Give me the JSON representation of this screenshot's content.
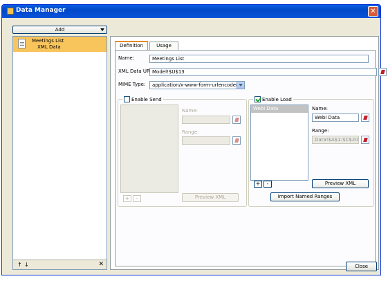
{
  "window": {
    "title": "Data Manager",
    "close_glyph": "✕"
  },
  "toolbar": {
    "add_label": "Add"
  },
  "connections": [
    {
      "name": "Meetings List",
      "type": "XML Data"
    }
  ],
  "left_footer": {
    "up": "↑",
    "down": "↓",
    "delete": "✕"
  },
  "tabs": [
    {
      "label": "Definition",
      "active": true
    },
    {
      "label": "Usage",
      "active": false
    }
  ],
  "definition": {
    "name_label": "Name:",
    "name_value": "Meetings List",
    "url_label": "XML Data URL:",
    "url_value": "Model!$U$13",
    "mime_label": "MIME Type:",
    "mime_value": "application/x-www-form-urlencoded"
  },
  "send": {
    "title": "Enable Send",
    "checked": false,
    "name_label": "Name:",
    "range_label": "Range:",
    "preview_label": "Preview XML",
    "add": "+",
    "remove": "-"
  },
  "load": {
    "title": "Enable Load",
    "checked": true,
    "items": [
      "Webi Data"
    ],
    "name_label": "Name:",
    "name_value": "Webi Data",
    "range_label": "Range:",
    "range_value": "Data!$A$1:$C$20",
    "preview_label": "Preview XML",
    "add": "+",
    "remove": "-"
  },
  "import_label": "Import Named Ranges",
  "footer": {
    "close_label": "Close"
  },
  "colors": {
    "titlebar": "#0a52d8",
    "selection": "#f8c45c",
    "accent_tab": "#e68b2c"
  },
  "icons": {
    "title": "data-manager-icon",
    "doc": "document-icon",
    "pick": "cell-selector-icon"
  }
}
